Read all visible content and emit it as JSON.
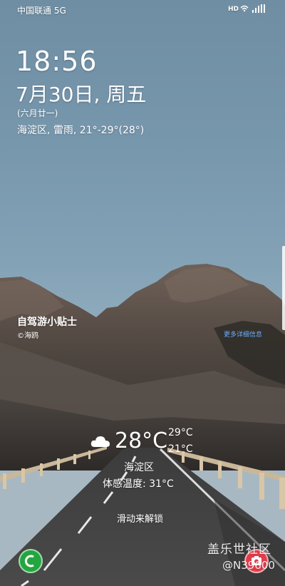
{
  "status_bar": {
    "carrier": "中国联通 5G",
    "hd_label": "HD",
    "icons": [
      "wifi-icon",
      "5g-signal-icon",
      "signal-icon"
    ]
  },
  "lock_clock": {
    "time": "18:56",
    "date": "7月30日, 周五",
    "lunar": "(六月廿一)",
    "weather_summary": "海淀区, 雷雨, 21°-29°(28°)"
  },
  "wallpaper_tip": {
    "title": "自驾游小贴士",
    "credit": "©海鸥",
    "more_link": "更多详细信息"
  },
  "weather_widget": {
    "icon": "cloud-icon",
    "temperature": "28°C",
    "high": "29°C",
    "low": "21°C",
    "location": "海淀区",
    "feels_like": "体感温度: 31°C"
  },
  "unlock": {
    "hint": "滑动来解锁"
  },
  "shortcuts": {
    "left": "phone-icon",
    "right": "camera-icon"
  },
  "watermark": {
    "brand": "盖乐世社区",
    "handle": "@N39600"
  },
  "colors": {
    "sky": "#7797ad",
    "link": "#6fb2ff",
    "phone": "#23a63f",
    "camera": "#e23d4c"
  }
}
